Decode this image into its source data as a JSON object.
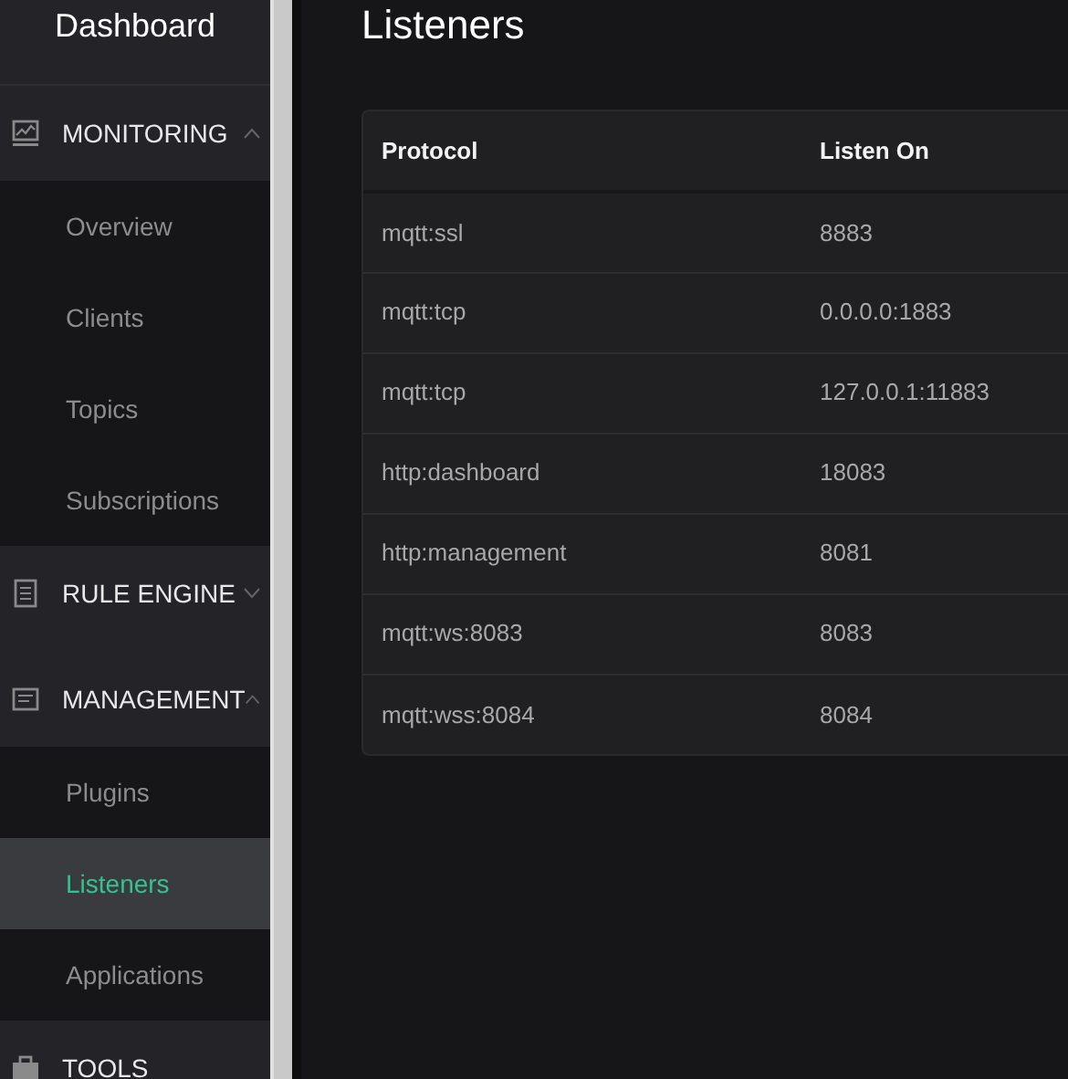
{
  "sidebar": {
    "brand": "Dashboard",
    "groups": [
      {
        "label": "MONITORING",
        "expanded": true,
        "children": [
          {
            "label": "Overview",
            "selected": false
          },
          {
            "label": "Clients",
            "selected": false
          },
          {
            "label": "Topics",
            "selected": false
          },
          {
            "label": "Subscriptions",
            "selected": false
          }
        ]
      },
      {
        "label": "RULE ENGINE",
        "expanded": false
      },
      {
        "label": "MANAGEMENT",
        "expanded": true,
        "children": [
          {
            "label": "Plugins",
            "selected": false
          },
          {
            "label": "Listeners",
            "selected": true
          },
          {
            "label": "Applications",
            "selected": false
          }
        ]
      },
      {
        "label": "TOOLS"
      }
    ]
  },
  "page": {
    "title": "Listeners",
    "table": {
      "columns": [
        "Protocol",
        "Listen On"
      ],
      "rows": [
        [
          "mqtt:ssl",
          "8883"
        ],
        [
          "mqtt:tcp",
          "0.0.0.0:1883"
        ],
        [
          "mqtt:tcp",
          "127.0.0.1:11883"
        ],
        [
          "http:dashboard",
          "18083"
        ],
        [
          "http:management",
          "8081"
        ],
        [
          "mqtt:ws:8083",
          "8083"
        ],
        [
          "mqtt:wss:8084",
          "8084"
        ]
      ]
    }
  }
}
